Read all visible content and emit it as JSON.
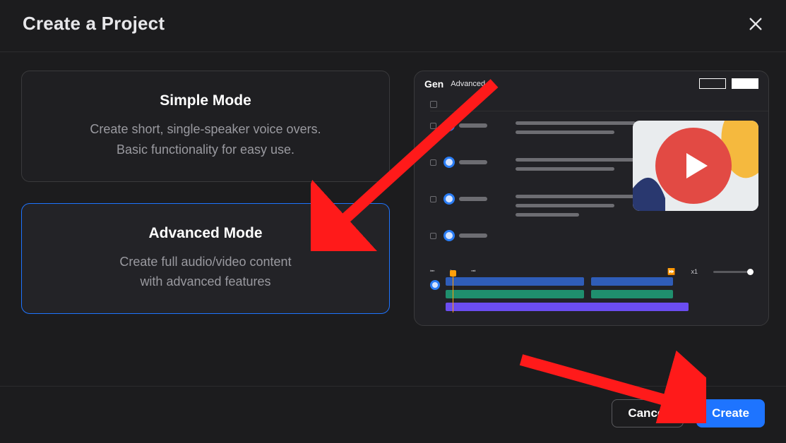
{
  "header": {
    "title": "Create a Project"
  },
  "modes": {
    "simple": {
      "title": "Simple Mode",
      "desc_l1": "Create short, single-speaker voice overs.",
      "desc_l2": "Basic functionality for easy use."
    },
    "advanced": {
      "title": "Advanced Mode",
      "desc_l1": "Create full audio/video content",
      "desc_l2": "with advanced features"
    }
  },
  "preview": {
    "brand_part1": "Gen",
    "mode_label": "Advanced",
    "transport_speed": "x1"
  },
  "footer": {
    "cancel": "Cancel",
    "create": "Create"
  }
}
